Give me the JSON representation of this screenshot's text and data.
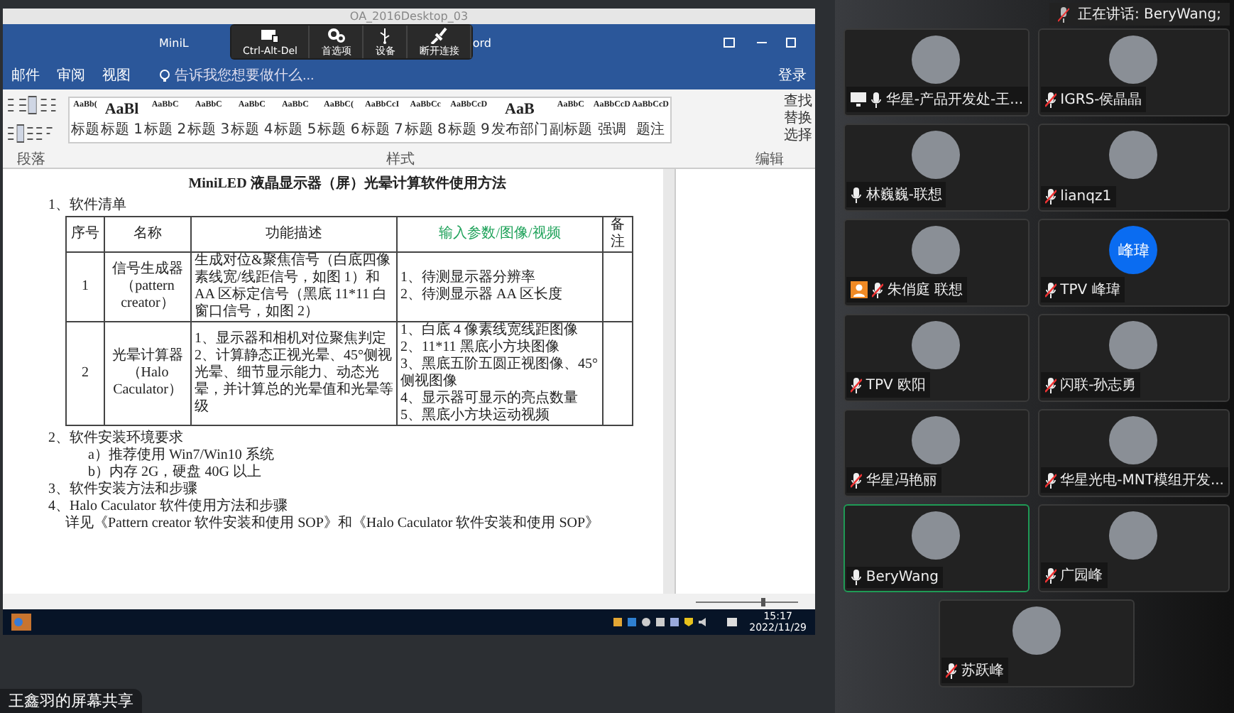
{
  "remote_window": {
    "title": "OA_2016Desktop_03"
  },
  "word": {
    "title_left": "MiniL",
    "title_right": "ord",
    "remote_toolbar": [
      {
        "label": "Ctrl-Alt-Del",
        "kind": "keys"
      },
      {
        "label": "首选项",
        "kind": "gears"
      },
      {
        "label": "设备",
        "kind": "usb"
      },
      {
        "label": "断开连接",
        "kind": "plug"
      }
    ],
    "ribbon_tabs": [
      "邮件",
      "审阅",
      "视图"
    ],
    "tell_me": {
      "placeholder": "告诉我您想要做什么..."
    },
    "sign_in": "登录",
    "styles": [
      {
        "preview": "AaBb(",
        "label": "标题"
      },
      {
        "preview": "AaBl",
        "label": "标题 1"
      },
      {
        "preview": "AaBbC",
        "label": "标题 2"
      },
      {
        "preview": "AaBbC",
        "label": "标题 3"
      },
      {
        "preview": "AaBbC",
        "label": "标题 4"
      },
      {
        "preview": "AaBbC",
        "label": "标题 5"
      },
      {
        "preview": "AaBbC(",
        "label": "标题 6"
      },
      {
        "preview": "AaBbCcI",
        "label": "标题 7"
      },
      {
        "preview": "AaBbCc",
        "label": "标题 8"
      },
      {
        "preview": "AaBbCcD",
        "label": "标题 9"
      },
      {
        "preview": "AaB",
        "label": "发布部门"
      },
      {
        "preview": "AaBbC",
        "label": "副标题"
      },
      {
        "preview": "AaBbCcD",
        "label": "强调"
      },
      {
        "preview": "AaBbCcD",
        "label": "题注"
      }
    ],
    "editing": [
      "查找",
      "替换",
      "选择"
    ],
    "groups": [
      "段落",
      "样式",
      "编辑"
    ]
  },
  "document": {
    "title": "MiniLED 液晶显示器（屏）光晕计算软件使用方法",
    "section_1": "1、软件清单",
    "table": {
      "columns": [
        {
          "label": "序号",
          "highlight": false
        },
        {
          "label": "名称",
          "highlight": false
        },
        {
          "label": "功能描述",
          "highlight": false
        },
        {
          "label": "输入参数/图像/视频",
          "highlight": true
        },
        {
          "label": "备注",
          "highlight": false
        }
      ],
      "rows": [
        {
          "no": "1",
          "name": "信号生成器（pattern creator）",
          "function": [
            "生成对位&聚焦信号（白底四像素线宽/线距信号，如图 1）和 AA 区标定信号（黑底 11*11 白窗口信号，如图 2）"
          ],
          "inputs": [
            "1、待测显示器分辨率",
            "2、待测显示器 AA 区长度"
          ]
        },
        {
          "no": "2",
          "name": "光晕计算器（Halo Caculator）",
          "function": [
            "1、显示器和相机对位聚焦判定",
            "2、计算静态正视光晕、45°侧视光晕、细节显示能力、动态光晕，并计算总的光晕值和光晕等级"
          ],
          "inputs": [
            "1、白底 4 像素线宽线距图像",
            "2、11*11 黑底小方块图像",
            "3、黑底五阶五圆正视图像、45°侧视图像",
            "4、显示器可显示的亮点数量",
            "5、黑底小方块运动视频"
          ]
        }
      ]
    },
    "section_2": "2、软件安装环境要求",
    "requirements": [
      "a）推荐使用 Win7/Win10 系统",
      "b）内存 2G，硬盘 40G 以上"
    ],
    "section_3": "3、软件安装方法和步骤",
    "section_4": "4、Halo Caculator 软件使用方法和步骤",
    "paragraph": "详见《Pattern creator 软件安装和使用 SOP》和《Halo Caculator 软件安装和使用 SOP》"
  },
  "taskbar": {
    "time": "15:17",
    "date": "2022/11/29"
  },
  "share_label": "王鑫羽的屏幕共享",
  "speaking": "正在讲话: BeryWang;",
  "participants": [
    {
      "name": "华星-产品开发处-王...",
      "muted": false,
      "sharing": true,
      "guest": false,
      "selected": false
    },
    {
      "name": "IGRS-侯晶晶",
      "muted": true,
      "sharing": false,
      "guest": false,
      "selected": false
    },
    {
      "name": "林巍巍-联想",
      "muted": false,
      "sharing": false,
      "guest": false,
      "selected": false
    },
    {
      "name": "lianqz1",
      "muted": true,
      "sharing": false,
      "guest": false,
      "selected": false
    },
    {
      "name": "朱俏庭 联想",
      "muted": true,
      "sharing": false,
      "guest": true,
      "selected": false
    },
    {
      "name": "TPV 峰瑋",
      "avatar_text": "峰瑋",
      "muted": true,
      "sharing": false,
      "guest": false,
      "selected": false
    },
    {
      "name": "TPV 欧阳",
      "muted": true,
      "sharing": false,
      "guest": false,
      "selected": false
    },
    {
      "name": "闪联-孙志勇",
      "muted": true,
      "sharing": false,
      "guest": false,
      "selected": false
    },
    {
      "name": "华星冯艳丽",
      "muted": true,
      "sharing": false,
      "guest": false,
      "selected": false
    },
    {
      "name": "华星光电-MNT模组开发...",
      "muted": true,
      "sharing": false,
      "guest": false,
      "selected": false
    },
    {
      "name": "BeryWang",
      "muted": false,
      "sharing": false,
      "guest": false,
      "selected": true
    },
    {
      "name": "广园峰",
      "muted": true,
      "sharing": false,
      "guest": false,
      "selected": false
    },
    {
      "name": "苏跃峰",
      "muted": true,
      "sharing": false,
      "guest": false,
      "selected": false
    }
  ]
}
